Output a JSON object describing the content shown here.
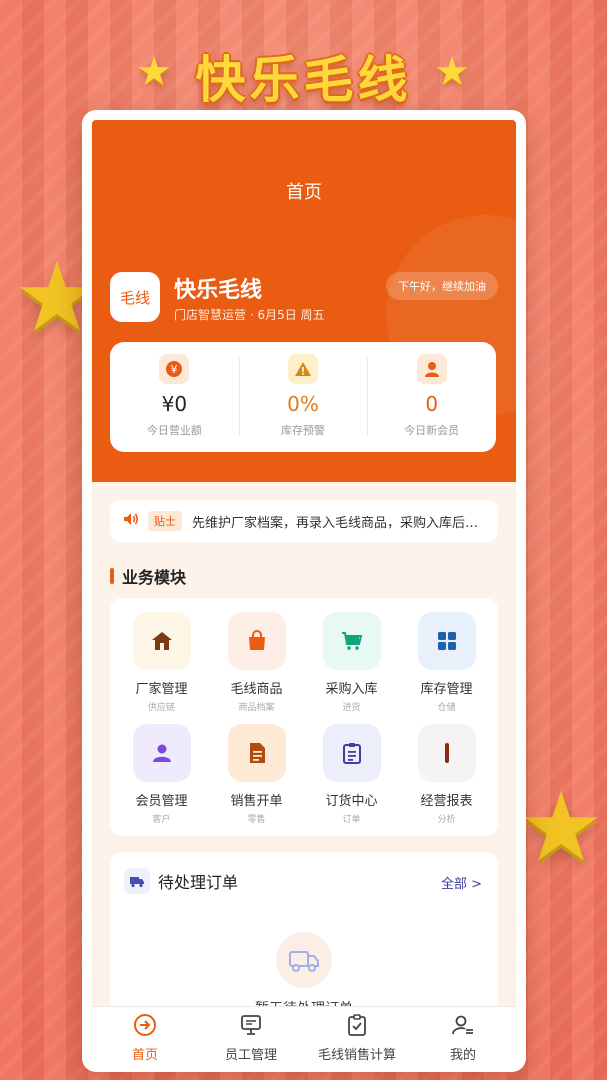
{
  "promo": {
    "title": "快乐毛线"
  },
  "header": {
    "title": "首页"
  },
  "store": {
    "logo_text": "毛线",
    "name": "快乐毛线",
    "subtitle": "门店智慧运营 · 6月5日 周五",
    "greeting": "下午好，继续加油"
  },
  "stats": [
    {
      "value": "¥0",
      "label": "今日营业额",
      "icon": "yuan-icon"
    },
    {
      "value": "0%",
      "label": "库存预警",
      "icon": "warning-icon"
    },
    {
      "value": "0",
      "label": "今日新会员",
      "icon": "user-icon"
    }
  ],
  "notice": {
    "tag": "贴士",
    "text": "先维护厂家档案，再录入毛线商品，采购入库后…"
  },
  "modules_section": {
    "title": "业务模块"
  },
  "modules": [
    {
      "label": "厂家管理",
      "sub": "供应链",
      "icon": "house-icon",
      "bg": "#fdf6e6",
      "color": "#7a3b10"
    },
    {
      "label": "毛线商品",
      "sub": "商品档案",
      "icon": "shopping-bag-icon",
      "bg": "#fdeee6",
      "color": "#e95c12"
    },
    {
      "label": "采购入库",
      "sub": "进货",
      "icon": "cart-icon",
      "bg": "#e8f8f3",
      "color": "#14a37f"
    },
    {
      "label": "库存管理",
      "sub": "仓储",
      "icon": "grid-icon",
      "bg": "#e8f1fb",
      "color": "#1d63a8"
    },
    {
      "label": "会员管理",
      "sub": "客户",
      "icon": "member-icon",
      "bg": "#f0ebfc",
      "color": "#7d48e0"
    },
    {
      "label": "销售开单",
      "sub": "零售",
      "icon": "document-icon",
      "bg": "#fde9d6",
      "color": "#b34d0f"
    },
    {
      "label": "订货中心",
      "sub": "订单",
      "icon": "checklist-icon",
      "bg": "#eceefb",
      "color": "#3e3f9b"
    },
    {
      "label": "经营报表",
      "sub": "分析",
      "icon": "bar-icon",
      "bg": "#f6f4f3",
      "color": "#8a2a12"
    }
  ],
  "orders": {
    "title": "待处理订单",
    "all_link": "全部 >",
    "empty_text": "暂无待处理订单"
  },
  "tabs": [
    {
      "label": "首页",
      "icon": "arrow-circle-icon",
      "active": true
    },
    {
      "label": "员工管理",
      "icon": "monitor-icon",
      "active": false
    },
    {
      "label": "毛线销售计算",
      "icon": "clipboard-check-icon",
      "active": false
    },
    {
      "label": "我的",
      "icon": "person-list-icon",
      "active": false
    }
  ],
  "colors": {
    "brand": "#e95c12",
    "background": "#f4826a",
    "promo_title": "#ffd93b"
  }
}
